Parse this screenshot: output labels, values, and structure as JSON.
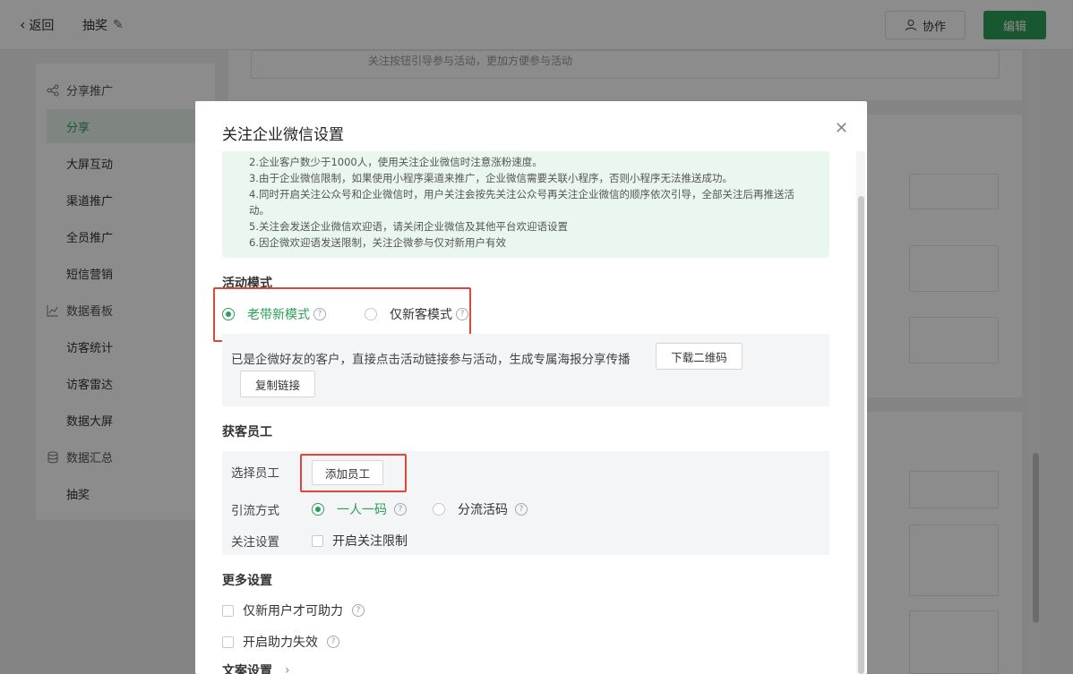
{
  "topbar": {
    "back_label": "返回",
    "page_title": "抽奖",
    "collab_label": "协作",
    "edit_label": "编辑"
  },
  "sidebar": {
    "groups": [
      {
        "label": "分享推广",
        "icon": "share-icon"
      },
      {
        "label": "数据看板",
        "icon": "chart-icon"
      },
      {
        "label": "数据汇总",
        "icon": "database-icon"
      }
    ],
    "items": [
      {
        "label": "分享",
        "active": true
      },
      {
        "label": "大屏互动"
      },
      {
        "label": "渠道推广"
      },
      {
        "label": "全员推广"
      },
      {
        "label": "短信营销"
      },
      {
        "label": "访客统计"
      },
      {
        "label": "访客雷达"
      },
      {
        "label": "数据大屏"
      },
      {
        "label": "抽奖"
      }
    ]
  },
  "background": {
    "partial_text": "关注按钮引导参与活动，更加方便参与活动"
  },
  "modal": {
    "title": "关注企业微信设置",
    "notice_lines": [
      "2.企业客户数少于1000人，使用关注企业微信时注意涨粉速度。",
      "3.由于企业微信限制，如果使用小程序渠道来推广，企业微信需要关联小程序，否则小程序无法推送成功。",
      "4.同时开启关注公众号和企业微信时，用户关注会按先关注公众号再关注企业微信的顺序依次引导，全部关注后再推送活",
      "动。",
      "5.关注会发送企业微信欢迎语，请关闭企业微信及其他平台欢迎语设置",
      "6.因企微欢迎语发送限制，关注企微参与仅对新用户有效"
    ],
    "activity_mode": {
      "title": "活动模式",
      "options": [
        {
          "label": "老带新模式",
          "selected": true
        },
        {
          "label": "仅新客模式",
          "selected": false
        }
      ],
      "description": "已是企微好友的客户，直接点击活动链接参与活动，生成专属海报分享传播",
      "download_qr_label": "下载二维码",
      "copy_link_label": "复制链接"
    },
    "staff": {
      "title": "获客员工",
      "select_label": "选择员工",
      "add_staff_label": "添加员工",
      "traffic_label": "引流方式",
      "traffic_options": [
        {
          "label": "一人一码",
          "selected": true
        },
        {
          "label": "分流活码",
          "selected": false
        }
      ],
      "follow_label": "关注设置",
      "follow_limit_label": "开启关注限制",
      "follow_limit_checked": false
    },
    "more": {
      "title": "更多设置",
      "new_user_only_label": "仅新用户才可助力",
      "new_user_only_checked": false,
      "help_expire_label": "开启助力失效",
      "help_expire_checked": false,
      "copy_settings_label": "文案设置"
    }
  },
  "colors": {
    "brand_green": "#2c9e56",
    "highlight_red": "#e0453a",
    "notice_bg": "#e9f7ee"
  }
}
